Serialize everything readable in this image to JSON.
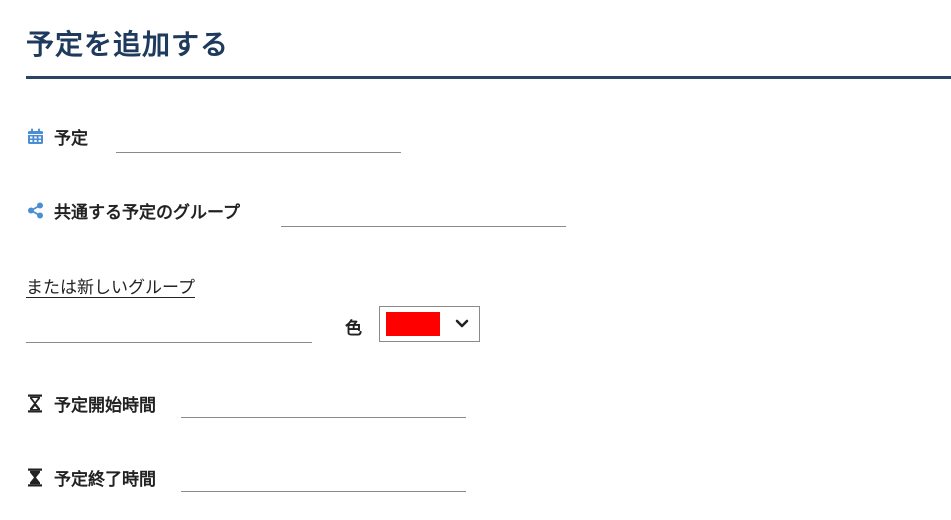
{
  "page": {
    "title": "予定を追加する"
  },
  "form": {
    "event": {
      "label": "予定",
      "value": "",
      "icon": "calendar-icon"
    },
    "shared_group": {
      "label": "共通する予定のグループ",
      "value": "",
      "icon": "share-icon"
    },
    "new_group": {
      "link_label": "または新しいグループ",
      "value": ""
    },
    "color": {
      "label": "色",
      "selected_color": "#ff0000",
      "icon": "chevron-down-icon"
    },
    "start_time": {
      "label": "予定開始時間",
      "value": "",
      "icon": "hourglass-icon"
    },
    "end_time": {
      "label": "予定終了時間",
      "value": "",
      "icon": "hourglass-icon"
    }
  },
  "colors": {
    "title": "#1e3a5c",
    "rule": "#2a4560",
    "icon_blue": "#4a8fd4",
    "icon_dark": "#222222"
  }
}
